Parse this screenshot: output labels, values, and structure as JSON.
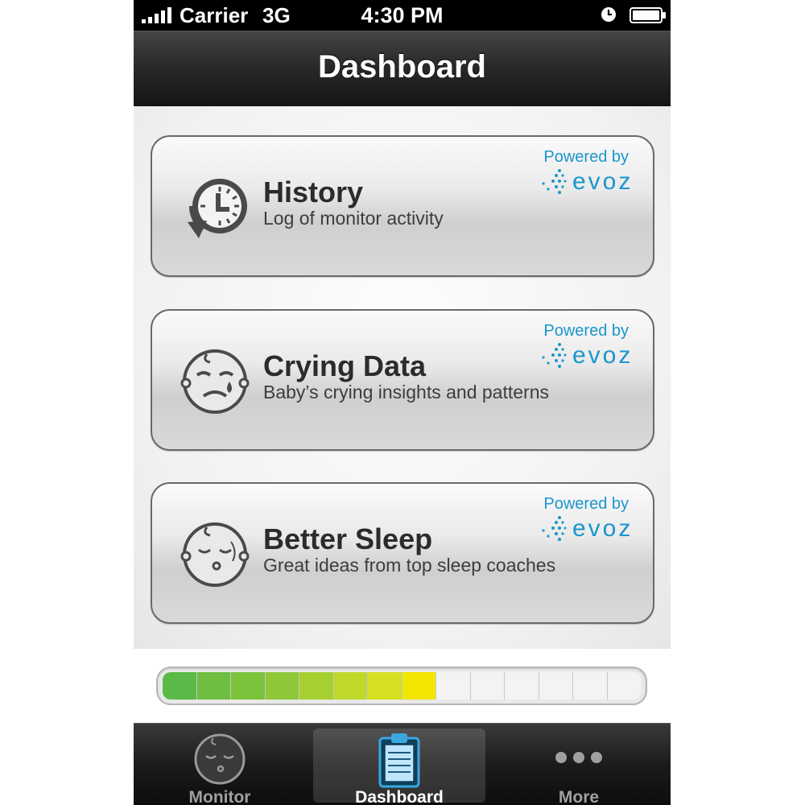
{
  "status_bar": {
    "carrier": "Carrier",
    "network": "3G",
    "time": "4:30 PM"
  },
  "nav": {
    "title": "Dashboard"
  },
  "cards": [
    {
      "title": "History",
      "subtitle": "Log of monitor activity",
      "powered_by": "Powered by",
      "brand": "evoz",
      "icon": "clock-history-icon"
    },
    {
      "title": "Crying Data",
      "subtitle": "Baby’s crying insights and patterns",
      "powered_by": "Powered by",
      "brand": "evoz",
      "icon": "crying-baby-icon"
    },
    {
      "title": "Better Sleep",
      "subtitle": "Great ideas from top sleep coaches",
      "powered_by": "Powered by",
      "brand": "evoz",
      "icon": "sleeping-baby-icon"
    }
  ],
  "sound_level": {
    "segments_total": 14,
    "segments_filled": 8,
    "level": 0.571,
    "colors": [
      "#5bb947",
      "#6fbe41",
      "#7cc33c",
      "#8ec838",
      "#a6d02f",
      "#bfd829",
      "#d6e021",
      "#f2e600"
    ]
  },
  "tabs": [
    {
      "label": "Monitor",
      "icon": "baby-face-icon",
      "active": false
    },
    {
      "label": "Dashboard",
      "icon": "clipboard-icon",
      "active": true
    },
    {
      "label": "More",
      "icon": "more-dots-icon",
      "active": false
    }
  ],
  "theme": {
    "accent": "#1a96cc",
    "nav_bg": "#2a2a2a"
  }
}
